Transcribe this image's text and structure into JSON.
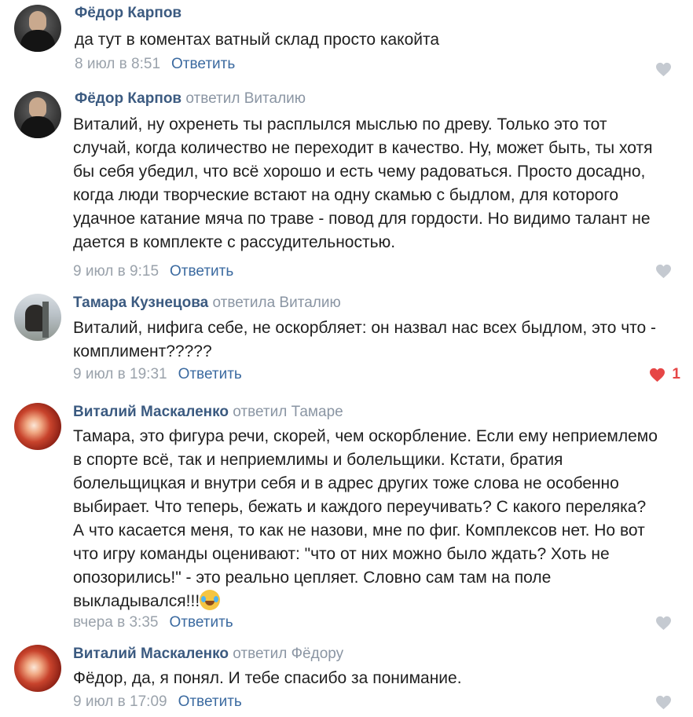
{
  "comments": [
    {
      "author": "Фёдор Карпов",
      "reply_to": "",
      "text": "да тут в коментах ватный склад просто какойта",
      "date": "8 июл в 8:51",
      "reply_label": "Ответить",
      "liked": false,
      "likes": ""
    },
    {
      "author": "Фёдор Карпов",
      "reply_to": "ответил Виталию",
      "text": "Виталий, ну охренеть ты расплылся мыслью по древу. Только это тот\nслучай, когда количество не переходит в качество. Ну, может быть, ты хотя\nбы себя убедил, что всё хорошо и есть чему радоваться. Просто досадно,\nкогда люди творческие встают на одну скамью с быдлом, для которого\nудачное катание мяча по траве - повод для гордости. Но видимо талант не\nдается в комплекте с рассудительностью.",
      "date": "9 июл в 9:15",
      "reply_label": "Ответить",
      "liked": false,
      "likes": ""
    },
    {
      "author": "Тамара Кузнецова",
      "reply_to": "ответила Виталию",
      "text": "Виталий, нифига себе, не оскорбляет: он назвал нас всех быдлом, это что -\nкомплимент?????",
      "date": "9 июл в 19:31",
      "reply_label": "Ответить",
      "liked": true,
      "likes": "1"
    },
    {
      "author": "Виталий Маскаленко",
      "reply_to": "ответил Тамаре",
      "text": "Тамара, это фигура речи, скорей, чем оскорбление. Если ему неприемлемо\nв спорте всё, так и неприемлимы и болельщики. Кстати, братия\nболельщицкая и внутри себя и в адрес других тоже слова не особенно\nвыбирает. Что теперь, бежать и каждого переучивать? С какого переляка?\nА что касается меня, то как не назови, мне по фиг. Комплексов нет. Но вот\nчто игру команды оценивают: \"что от них можно было ждать? Хоть не\nопозорились!\" - это реально цепляет. Словно сам там на поле\nвыкладывался!!!",
      "date": "вчера в 3:35",
      "reply_label": "Ответить",
      "liked": false,
      "likes": ""
    },
    {
      "author": "Виталий Маскаленко",
      "reply_to": "ответил Фёдору",
      "text": "Фёдор, да, я понял. И тебе спасибо за понимание.",
      "date": "9 июл в 17:09",
      "reply_label": "Ответить",
      "liked": false,
      "likes": ""
    }
  ],
  "icons": {
    "like": "heart-icon",
    "emoji": "joy-tears-emoji"
  },
  "colors": {
    "author": "#3b5a80",
    "reply_link": "#3b6aa0",
    "meta": "#9aa2ab",
    "like_inactive": "#c5cad1",
    "like_active": "#e64646"
  }
}
